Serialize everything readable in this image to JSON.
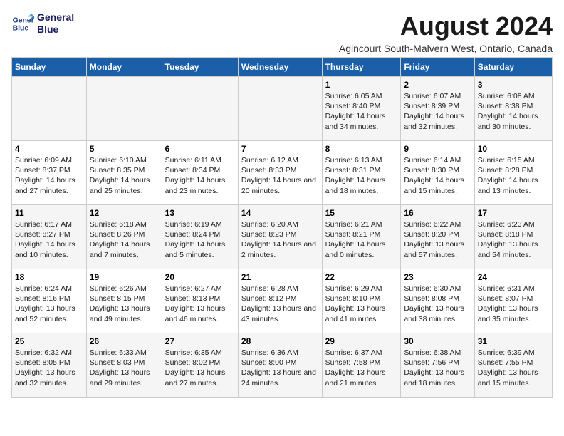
{
  "logo": {
    "line1": "General",
    "line2": "Blue"
  },
  "title": "August 2024",
  "subtitle": "Agincourt South-Malvern West, Ontario, Canada",
  "days_of_week": [
    "Sunday",
    "Monday",
    "Tuesday",
    "Wednesday",
    "Thursday",
    "Friday",
    "Saturday"
  ],
  "weeks": [
    [
      {
        "day": "",
        "content": ""
      },
      {
        "day": "",
        "content": ""
      },
      {
        "day": "",
        "content": ""
      },
      {
        "day": "",
        "content": ""
      },
      {
        "day": "1",
        "content": "Sunrise: 6:05 AM\nSunset: 8:40 PM\nDaylight: 14 hours and 34 minutes."
      },
      {
        "day": "2",
        "content": "Sunrise: 6:07 AM\nSunset: 8:39 PM\nDaylight: 14 hours and 32 minutes."
      },
      {
        "day": "3",
        "content": "Sunrise: 6:08 AM\nSunset: 8:38 PM\nDaylight: 14 hours and 30 minutes."
      }
    ],
    [
      {
        "day": "4",
        "content": "Sunrise: 6:09 AM\nSunset: 8:37 PM\nDaylight: 14 hours and 27 minutes."
      },
      {
        "day": "5",
        "content": "Sunrise: 6:10 AM\nSunset: 8:35 PM\nDaylight: 14 hours and 25 minutes."
      },
      {
        "day": "6",
        "content": "Sunrise: 6:11 AM\nSunset: 8:34 PM\nDaylight: 14 hours and 23 minutes."
      },
      {
        "day": "7",
        "content": "Sunrise: 6:12 AM\nSunset: 8:33 PM\nDaylight: 14 hours and 20 minutes."
      },
      {
        "day": "8",
        "content": "Sunrise: 6:13 AM\nSunset: 8:31 PM\nDaylight: 14 hours and 18 minutes."
      },
      {
        "day": "9",
        "content": "Sunrise: 6:14 AM\nSunset: 8:30 PM\nDaylight: 14 hours and 15 minutes."
      },
      {
        "day": "10",
        "content": "Sunrise: 6:15 AM\nSunset: 8:28 PM\nDaylight: 14 hours and 13 minutes."
      }
    ],
    [
      {
        "day": "11",
        "content": "Sunrise: 6:17 AM\nSunset: 8:27 PM\nDaylight: 14 hours and 10 minutes."
      },
      {
        "day": "12",
        "content": "Sunrise: 6:18 AM\nSunset: 8:26 PM\nDaylight: 14 hours and 7 minutes."
      },
      {
        "day": "13",
        "content": "Sunrise: 6:19 AM\nSunset: 8:24 PM\nDaylight: 14 hours and 5 minutes."
      },
      {
        "day": "14",
        "content": "Sunrise: 6:20 AM\nSunset: 8:23 PM\nDaylight: 14 hours and 2 minutes."
      },
      {
        "day": "15",
        "content": "Sunrise: 6:21 AM\nSunset: 8:21 PM\nDaylight: 14 hours and 0 minutes."
      },
      {
        "day": "16",
        "content": "Sunrise: 6:22 AM\nSunset: 8:20 PM\nDaylight: 13 hours and 57 minutes."
      },
      {
        "day": "17",
        "content": "Sunrise: 6:23 AM\nSunset: 8:18 PM\nDaylight: 13 hours and 54 minutes."
      }
    ],
    [
      {
        "day": "18",
        "content": "Sunrise: 6:24 AM\nSunset: 8:16 PM\nDaylight: 13 hours and 52 minutes."
      },
      {
        "day": "19",
        "content": "Sunrise: 6:26 AM\nSunset: 8:15 PM\nDaylight: 13 hours and 49 minutes."
      },
      {
        "day": "20",
        "content": "Sunrise: 6:27 AM\nSunset: 8:13 PM\nDaylight: 13 hours and 46 minutes."
      },
      {
        "day": "21",
        "content": "Sunrise: 6:28 AM\nSunset: 8:12 PM\nDaylight: 13 hours and 43 minutes."
      },
      {
        "day": "22",
        "content": "Sunrise: 6:29 AM\nSunset: 8:10 PM\nDaylight: 13 hours and 41 minutes."
      },
      {
        "day": "23",
        "content": "Sunrise: 6:30 AM\nSunset: 8:08 PM\nDaylight: 13 hours and 38 minutes."
      },
      {
        "day": "24",
        "content": "Sunrise: 6:31 AM\nSunset: 8:07 PM\nDaylight: 13 hours and 35 minutes."
      }
    ],
    [
      {
        "day": "25",
        "content": "Sunrise: 6:32 AM\nSunset: 8:05 PM\nDaylight: 13 hours and 32 minutes."
      },
      {
        "day": "26",
        "content": "Sunrise: 6:33 AM\nSunset: 8:03 PM\nDaylight: 13 hours and 29 minutes."
      },
      {
        "day": "27",
        "content": "Sunrise: 6:35 AM\nSunset: 8:02 PM\nDaylight: 13 hours and 27 minutes."
      },
      {
        "day": "28",
        "content": "Sunrise: 6:36 AM\nSunset: 8:00 PM\nDaylight: 13 hours and 24 minutes."
      },
      {
        "day": "29",
        "content": "Sunrise: 6:37 AM\nSunset: 7:58 PM\nDaylight: 13 hours and 21 minutes."
      },
      {
        "day": "30",
        "content": "Sunrise: 6:38 AM\nSunset: 7:56 PM\nDaylight: 13 hours and 18 minutes."
      },
      {
        "day": "31",
        "content": "Sunrise: 6:39 AM\nSunset: 7:55 PM\nDaylight: 13 hours and 15 minutes."
      }
    ]
  ]
}
